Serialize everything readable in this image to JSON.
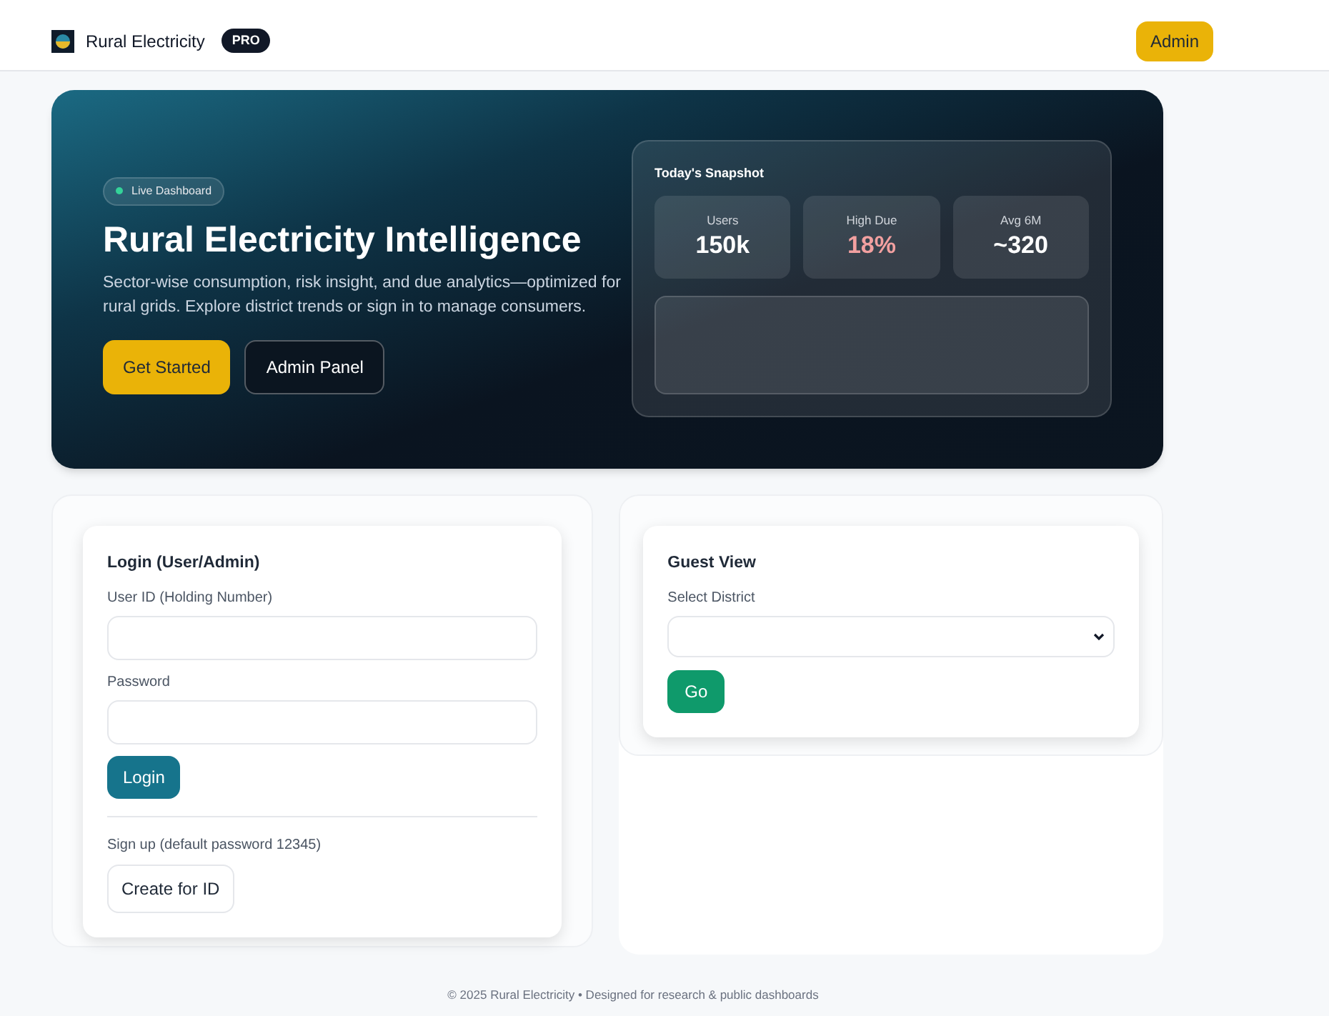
{
  "header": {
    "brand": "Rural Electricity",
    "badge": "PRO",
    "admin_button": "Admin"
  },
  "hero": {
    "status_pill": "Live Dashboard",
    "title": "Rural Electricity Intelligence",
    "description": "Sector-wise consumption, risk insight, and due analytics—optimized for rural grids. Explore district trends or sign in to manage consumers.",
    "buttons": [
      {
        "label": "Get Started",
        "kind": "primary"
      },
      {
        "label": "Admin Panel",
        "kind": "outline"
      }
    ],
    "snapshot": {
      "title": "Today's Snapshot",
      "stats": [
        {
          "label": "Users",
          "value": "150k",
          "color": "#ffffff"
        },
        {
          "label": "High Due",
          "value": "18%",
          "color": "#f2a0a0"
        },
        {
          "label": "Avg 6M",
          "value": "~320",
          "color": "#ffffff"
        }
      ]
    }
  },
  "login": {
    "title": "Login (User/Admin)",
    "fields": [
      {
        "label": "User ID (Holding Number)"
      },
      {
        "label": "Password"
      }
    ],
    "button": "Login",
    "signup_text": "Sign up (default password 12345)",
    "signup_button": "Create for ID"
  },
  "guest": {
    "title": "Guest View",
    "select_label": "Select District",
    "button": "Go"
  },
  "footer": "© 2025 Rural Electricity • Designed for research & public dashboards"
}
